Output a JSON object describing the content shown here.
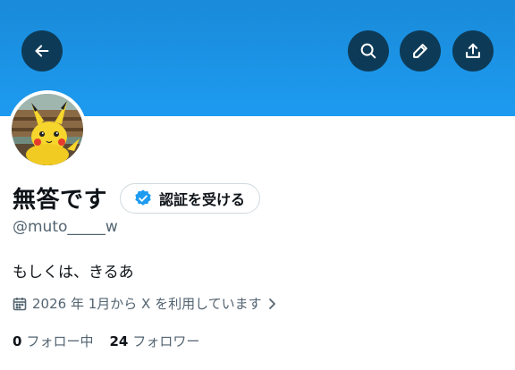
{
  "header": {
    "back_icon": "arrow-left-icon",
    "search_icon": "search-icon",
    "edit_icon": "pencil-icon",
    "share_icon": "share-upload-icon",
    "banner_color": "#1d9bf0",
    "button_color": "#0d3b57"
  },
  "profile": {
    "display_name": "無答です",
    "verify_button_label": "認証を受ける",
    "verify_badge_color": "#1d9bf0",
    "handle": "@muto_____w",
    "bio": "もしくは、きるあ",
    "joined": "2026 年 1月から X を利用しています",
    "following_count": "0",
    "following_label": "フォロー中",
    "followers_count": "24",
    "followers_label": "フォロワー"
  }
}
